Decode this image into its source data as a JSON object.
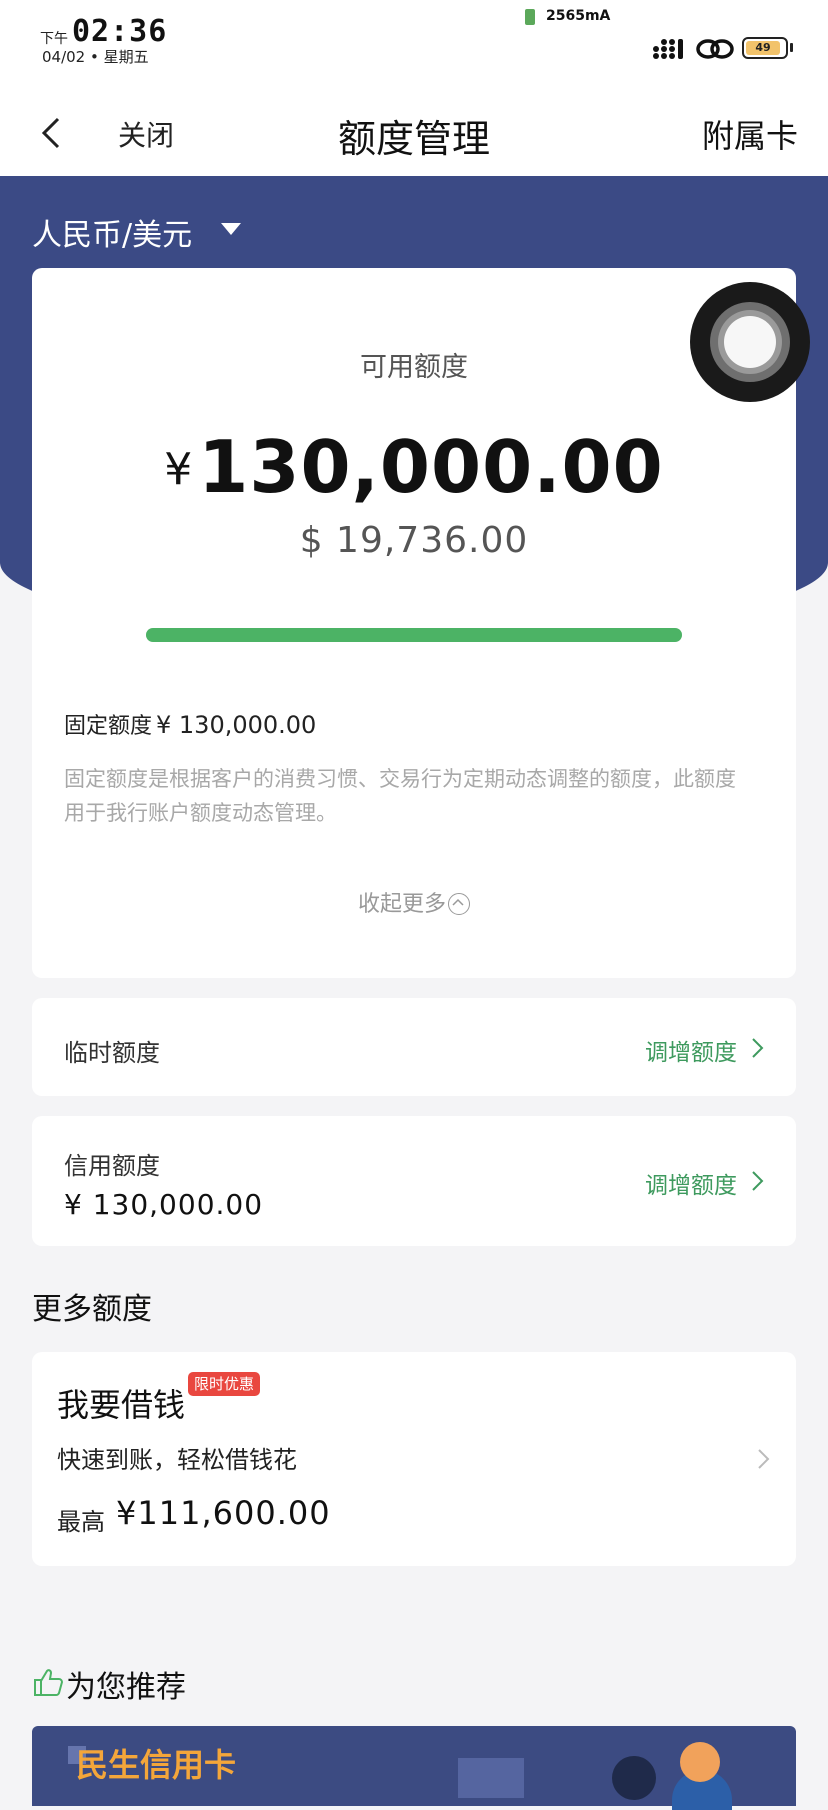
{
  "status_bar": {
    "ampm": "下午",
    "time": "02:36",
    "date": "04/02 • 星期五",
    "battery_mah": "2565mA",
    "battery_level": "49"
  },
  "nav": {
    "back_icon": "chevron-left-icon",
    "close_label": "关闭",
    "title": "额度管理",
    "right_label": "附属卡"
  },
  "currency_selector": {
    "label": "人民币/美元",
    "icon": "caret-down-icon"
  },
  "available": {
    "label": "可用额度",
    "cny_symbol": "¥",
    "cny_amount": "130,000.00",
    "usd_amount": "$ 19,736.00",
    "progress_fraction": 1.0,
    "progress_color": "#4cb365"
  },
  "fixed": {
    "label": "固定额度",
    "value": "¥ 130,000.00",
    "description": "固定额度是根据客户的消费习惯、交易行为定期动态调整的额度，此额度用于我行账户额度动态管理。",
    "collapse_label": "收起更多"
  },
  "temporary": {
    "label": "临时额度",
    "action_label": "调增额度"
  },
  "credit": {
    "label": "信用额度",
    "value": "¥ 130,000.00",
    "action_label": "调增额度"
  },
  "more_quota": {
    "title": "更多额度"
  },
  "loan": {
    "title": "我要借钱",
    "badge": "限时优惠",
    "subtitle": "快速到账，轻松借钱花",
    "max_label": "最高",
    "max_value": "¥111,600.00"
  },
  "recommend": {
    "title": "为您推荐",
    "icon": "thumbs-up-icon"
  },
  "banner": {
    "title": "民生信用卡"
  },
  "colors": {
    "header_blue": "#3b4a85",
    "accent_green": "#3e9a5e",
    "badge_red": "#e9473f",
    "banner_orange": "#f4a63a"
  }
}
